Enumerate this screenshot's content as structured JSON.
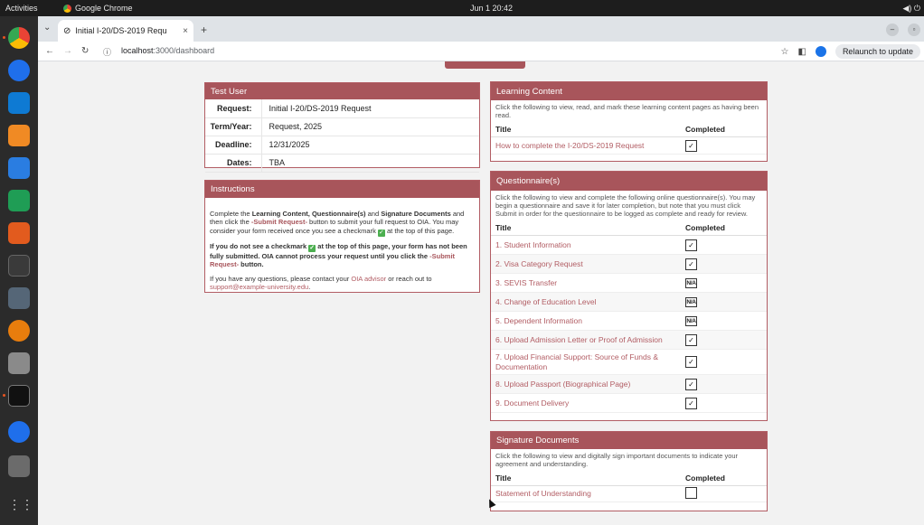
{
  "system": {
    "activities": "Activities",
    "app_name": "Google Chrome",
    "clock": "Jun 1  20:42",
    "tray": "◀) ⏻"
  },
  "browser": {
    "tab_title": "Initial I-20/DS-2019 Requ",
    "url_host": "localhost",
    "url_path": ":3000/dashboard",
    "relaunch_label": "Relaunch to update"
  },
  "test_user": {
    "header": "Test User",
    "rows": [
      {
        "key": "Request:",
        "value": "Initial I-20/DS-2019 Request"
      },
      {
        "key": "Term/Year:",
        "value": "Request, 2025"
      },
      {
        "key": "Deadline:",
        "value": "12/31/2025"
      },
      {
        "key": "Dates:",
        "value": "TBA"
      }
    ]
  },
  "instructions": {
    "header": "Instructions",
    "p1_a": "Complete the ",
    "p1_b": "Learning Content, Questionnaire(s)",
    "p1_c": " and ",
    "p1_d": "Signature Documents",
    "p1_e": " and then click the ",
    "p1_f": "-Submit Request-",
    "p1_g": " button to submit your full request to OIA. You may consider your form received once you see a checkmark ",
    "p1_h": " at the top of this page.",
    "p2_a": "If you do not see a checkmark ",
    "p2_b": " at the top of this page, your form has not been fully submitted. OIA cannot process your request until you click the ",
    "p2_c": "-Submit Request-",
    "p2_d": " button.",
    "p3_a": "If you have any questions, please contact your ",
    "p3_link": "OIA advisor",
    "p3_b": " or reach out to",
    "p3_email": "support@example-university.edu",
    "p3_c": "."
  },
  "learning": {
    "header": "Learning Content",
    "desc": "Click the following to view, read, and mark these learning content pages as having been read.",
    "col_title": "Title",
    "col_completed": "Completed",
    "items": [
      {
        "title": "How to complete the I-20/DS-2019 Request",
        "status": "✓"
      }
    ]
  },
  "questionnaires": {
    "header": "Questionnaire(s)",
    "desc": "Click the following to view and complete the following online questionnaire(s). You may begin a questionnaire and save it for later completion, but note that you must click Submit in order for the questionnaire to be logged as complete and ready for review.",
    "col_title": "Title",
    "col_completed": "Completed",
    "items": [
      {
        "title": "1. Student Information",
        "status": "✓"
      },
      {
        "title": "2. Visa Category Request",
        "status": "✓"
      },
      {
        "title": "3. SEVIS Transfer",
        "status": "N/A"
      },
      {
        "title": "4. Change of Education Level",
        "status": "N/A"
      },
      {
        "title": "5. Dependent Information",
        "status": "N/A"
      },
      {
        "title": "6. Upload Admission Letter or Proof of Admission",
        "status": "✓"
      },
      {
        "title": "7. Upload Financial Support: Source of Funds & Documentation",
        "status": "✓"
      },
      {
        "title": "8. Upload Passport (Biographical Page)",
        "status": "✓"
      },
      {
        "title": "9. Document Delivery",
        "status": "✓"
      }
    ]
  },
  "signatures": {
    "header": "Signature Documents",
    "desc": "Click the following to view and digitally sign important documents to indicate your agreement and understanding.",
    "col_title": "Title",
    "col_completed": "Completed",
    "items": [
      {
        "title": "Statement of Understanding",
        "status": ""
      }
    ]
  },
  "colors": {
    "accent": "#a8555b",
    "link": "#b25d64",
    "check": "#4caf50"
  }
}
